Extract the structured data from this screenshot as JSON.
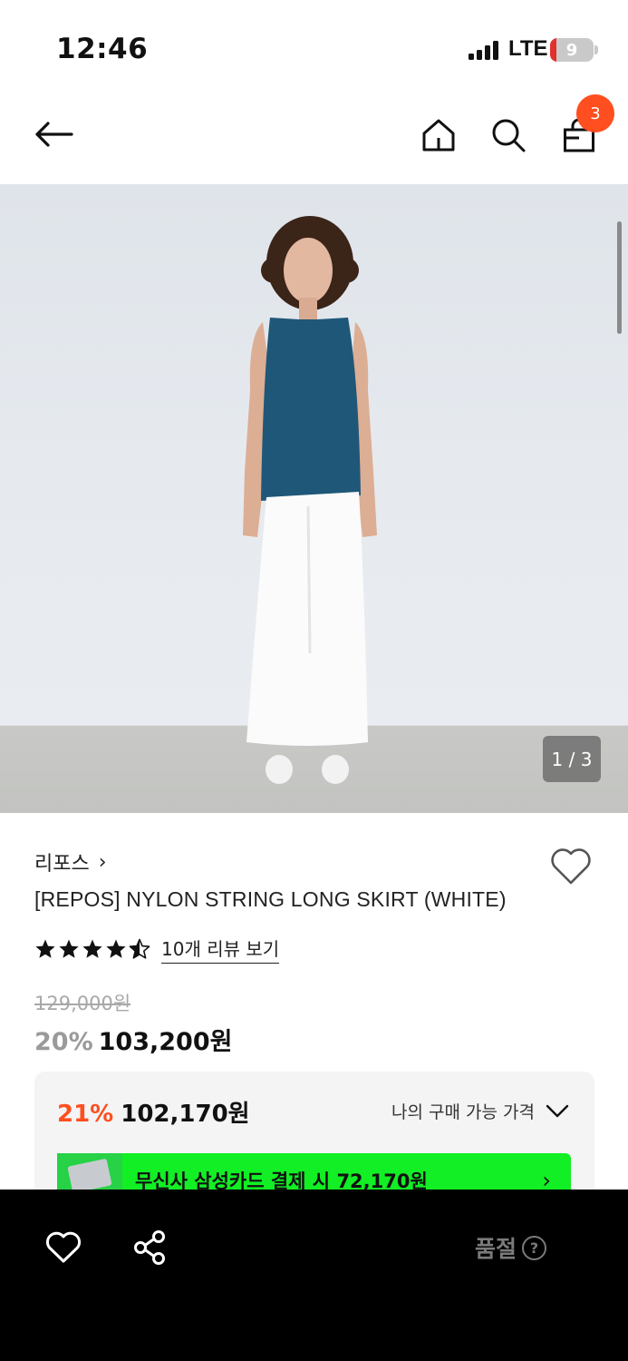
{
  "status_bar": {
    "time": "12:46",
    "network": "LTE",
    "battery_level": "9",
    "battery_color": "#e0312d"
  },
  "nav": {
    "icons": [
      "arrow-left-icon",
      "home-icon",
      "search-icon",
      "shopping-bag-icon"
    ],
    "cart_count": "3",
    "badge_color": "#ff4e1f"
  },
  "gallery": {
    "counter": "1 / 3"
  },
  "product": {
    "brand": "리포스",
    "brand_chevron": "›",
    "name": "[REPOS] NYLON STRING LONG SKIRT (WHITE)",
    "rating": 4.5,
    "review_link": "10개 리뷰 보기",
    "original_price": "129,000원",
    "discount_rate": "20%",
    "sale_price": "103,200원"
  },
  "benefit": {
    "rate": "21%",
    "price": "102,170원",
    "toggle_label": "나의 구매 가능 가격",
    "card_text": "무신사 삼성카드 결제 시 72,170원",
    "card_chevron": "›",
    "accent_color": "#ff4e1f",
    "card_color": "#12ef25"
  },
  "bottom_bar": {
    "status_label": "품절",
    "help_glyph": "?"
  }
}
